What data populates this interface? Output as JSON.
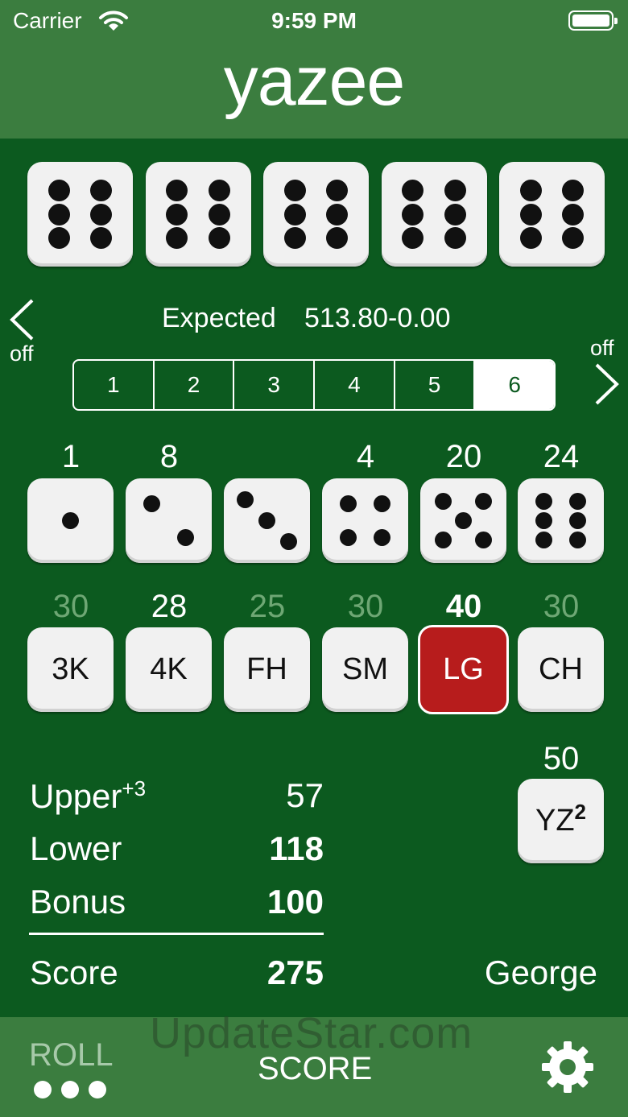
{
  "status_bar": {
    "carrier": "Carrier",
    "time": "9:59 PM",
    "icons": [
      "wifi-icon",
      "battery-icon"
    ]
  },
  "app": {
    "title": "yazee"
  },
  "dice": [
    6,
    6,
    6,
    6,
    6
  ],
  "expected": {
    "label": "Expected",
    "value": "513.80-0.00"
  },
  "nav": {
    "left_label": "off",
    "right_label": "off",
    "left_icon": "chevron-left-icon",
    "right_icon": "chevron-right-icon"
  },
  "segments": {
    "items": [
      "1",
      "2",
      "3",
      "4",
      "5",
      "6"
    ],
    "selected": "6"
  },
  "upper_section": [
    {
      "face": 1,
      "score": "1"
    },
    {
      "face": 2,
      "score": "8"
    },
    {
      "face": 3,
      "score": ""
    },
    {
      "face": 4,
      "score": "4"
    },
    {
      "face": 5,
      "score": "20"
    },
    {
      "face": 6,
      "score": "24"
    }
  ],
  "lower_section": [
    {
      "label": "3K",
      "score": "30",
      "scored": false,
      "selected": false
    },
    {
      "label": "4K",
      "score": "28",
      "scored": true,
      "selected": false
    },
    {
      "label": "FH",
      "score": "25",
      "scored": false,
      "selected": false
    },
    {
      "label": "SM",
      "score": "30",
      "scored": false,
      "selected": false
    },
    {
      "label": "LG",
      "score": "40",
      "scored": false,
      "selected": true
    },
    {
      "label": "CH",
      "score": "30",
      "scored": false,
      "selected": false
    }
  ],
  "yahtzee": {
    "label": "YZ",
    "superscript": "2",
    "score": "50"
  },
  "tally": {
    "upper_label": "Upper",
    "upper_bonus_note": "+3",
    "upper_value": "57",
    "lower_label": "Lower",
    "lower_value": "118",
    "bonus_label": "Bonus",
    "bonus_value": "100",
    "score_label": "Score",
    "score_value": "275"
  },
  "player": {
    "name": "George"
  },
  "footer": {
    "roll_label": "ROLL",
    "score_label": "SCORE",
    "rolls_remaining": 3,
    "settings_icon": "gear-icon"
  },
  "watermark": "UpdateStar.com",
  "colors": {
    "background": "#0c5a1f",
    "bar": "#3b7d3f",
    "selected": "#b71c1c",
    "dim_score": "#6ea774"
  }
}
